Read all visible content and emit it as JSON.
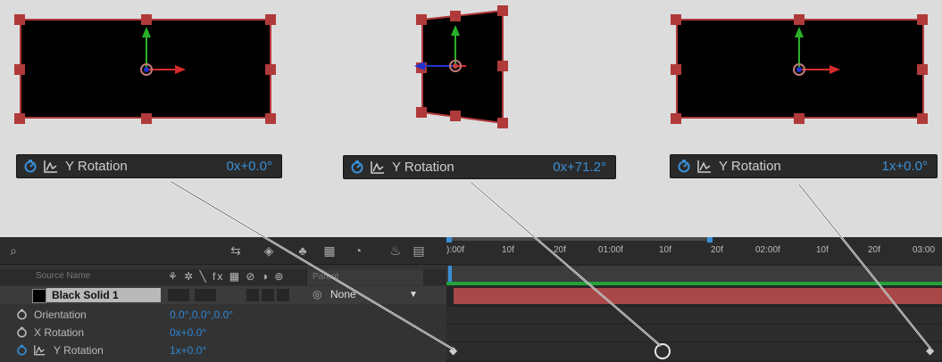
{
  "previews": [
    {
      "property": "Y Rotation",
      "value": "0x+0.0°"
    },
    {
      "property": "Y Rotation",
      "value": "0x+71.2°"
    },
    {
      "property": "Y Rotation",
      "value": "1x+0.0°"
    }
  ],
  "timeline": {
    "columns": {
      "source_name": "Source Name",
      "parent": "Parent"
    },
    "switch_icons": "⚘ ✲ ╲ fx ▦ ⊘ ◑ ⊚",
    "layer": {
      "name": "Black Solid 1",
      "parent_value": "None"
    },
    "properties": [
      {
        "name": "Orientation",
        "value": "0.0°,0.0°,0.0°"
      },
      {
        "name": "X Rotation",
        "value": "0x+0.0°"
      },
      {
        "name": "Y Rotation",
        "value": "1x+0.0°"
      }
    ],
    "ruler": [
      "):00f",
      "10f",
      "20f",
      "01:00f",
      "10f",
      "20f",
      "02:00f",
      "10f",
      "20f",
      "03:00"
    ]
  },
  "colors": {
    "accent_value": "#3a8fd6",
    "handle": "#b03a3a",
    "layer_bar": "#a84848",
    "track": "#23a23a"
  }
}
